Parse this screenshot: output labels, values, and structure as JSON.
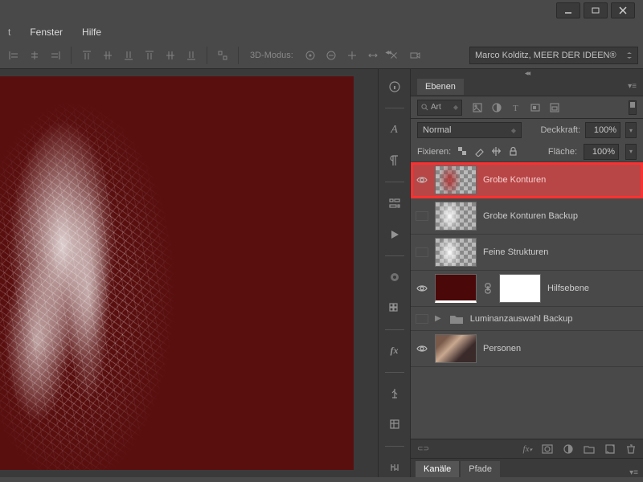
{
  "menu": {
    "fenster": "Fenster",
    "hilfe": "Hilfe"
  },
  "optbar": {
    "mode3d": "3D-Modus:"
  },
  "workspace": "Marco Kolditz, MEER DER IDEEN®",
  "panel": {
    "tab": "Ebenen",
    "search": "Art",
    "blend": "Normal",
    "opacity_label": "Deckkraft:",
    "opacity_value": "100%",
    "lock_label": "Fixieren:",
    "fill_label": "Fläche:",
    "fill_value": "100%"
  },
  "layers": {
    "l1": "Grobe Konturen",
    "l2": "Grobe Konturen Backup",
    "l3": "Feine Strukturen",
    "l4": "Hilfsebene",
    "l5": "Luminanzauswahl Backup",
    "l6": "Personen"
  },
  "bottom_tabs": {
    "kanaele": "Kanäle",
    "pfade": "Pfade"
  }
}
